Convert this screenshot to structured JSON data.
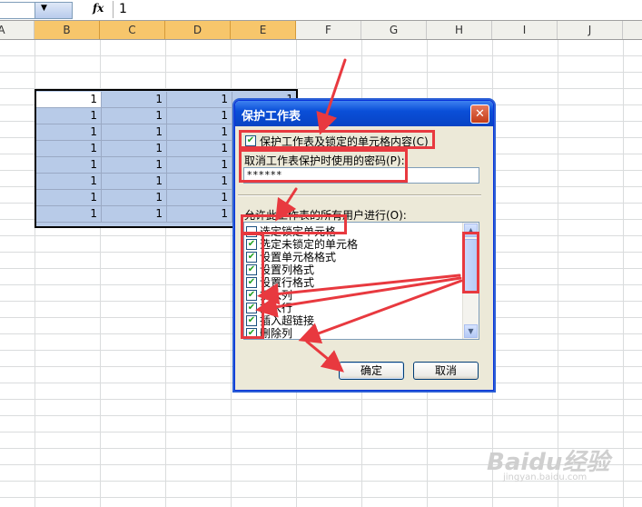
{
  "formula_bar": {
    "fx_symbol": "fx",
    "value": "1"
  },
  "columns": [
    {
      "name": "A",
      "selected": false
    },
    {
      "name": "B",
      "selected": true
    },
    {
      "name": "C",
      "selected": true
    },
    {
      "name": "D",
      "selected": true
    },
    {
      "name": "E",
      "selected": true
    },
    {
      "name": "F",
      "selected": false
    },
    {
      "name": "G",
      "selected": false
    },
    {
      "name": "H",
      "selected": false
    },
    {
      "name": "I",
      "selected": false
    },
    {
      "name": "J",
      "selected": false
    }
  ],
  "selected_cells": {
    "rows": [
      [
        "1",
        "1",
        "1",
        "1"
      ],
      [
        "1",
        "1",
        "1",
        "1"
      ],
      [
        "1",
        "1",
        "1",
        "1"
      ],
      [
        "1",
        "1",
        "1",
        "1"
      ],
      [
        "1",
        "1",
        "1",
        "1"
      ],
      [
        "1",
        "1",
        "1",
        "1"
      ],
      [
        "1",
        "1",
        "1",
        "1"
      ],
      [
        "1",
        "1",
        "1",
        "1"
      ]
    ]
  },
  "dialog": {
    "title": "保护工作表",
    "close_glyph": "✕",
    "protect_checkbox_label": "保护工作表及锁定的单元格内容(C)",
    "protect_checked": true,
    "password_label": "取消工作表保护时使用的密码(P):",
    "password_value": "******",
    "permissions_label": "允许此工作表的所有用户进行(O):",
    "permissions": [
      {
        "label": "选定锁定单元格",
        "checked": false
      },
      {
        "label": "选定未锁定的单元格",
        "checked": true
      },
      {
        "label": "设置单元格格式",
        "checked": true
      },
      {
        "label": "设置列格式",
        "checked": true
      },
      {
        "label": "设置行格式",
        "checked": true
      },
      {
        "label": "插入列",
        "checked": true
      },
      {
        "label": "插入行",
        "checked": true
      },
      {
        "label": "插入超链接",
        "checked": true
      },
      {
        "label": "删除列",
        "checked": true
      }
    ],
    "ok_label": "确定",
    "cancel_label": "取消"
  },
  "watermark": {
    "brand": "Baidu经验",
    "url": "jingyan.baidu.com"
  },
  "colors": {
    "annotation_red": "#e8393f",
    "selection_fill": "#b8cbe8",
    "header_selected": "#f7c66b"
  }
}
